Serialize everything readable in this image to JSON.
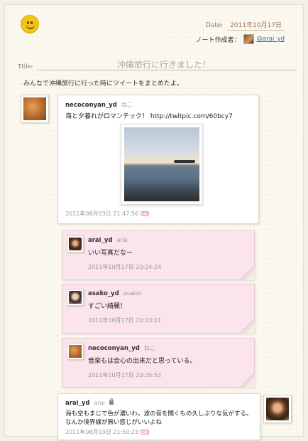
{
  "header": {
    "date_label": "Date:",
    "date_value": "2011年10月17日",
    "author_label": "ノート作成者：",
    "author_handle": "@arai_yd",
    "title_label": "Title:",
    "title": "沖縄旅行に行きました！",
    "summary": "みんなで沖縄旅行に行った時にツイートをまとめたよ。"
  },
  "tweets": [
    {
      "user": "necoconyan_yd",
      "name": "ねこ",
      "text": "海と夕暮れがロマンチック！ http://twitpic.com/60bcy7",
      "time": "2011年08月03日 21:47:56"
    },
    {
      "user": "arai_yd",
      "name": "arai",
      "text": "いい写真だなー",
      "time": "2011年10月17日 20:24:24"
    },
    {
      "user": "asako_yd",
      "name": "asakoi",
      "text": "すごい綺麗！",
      "time": "2011年10月17日 20:33:01"
    },
    {
      "user": "necoconyan_yd",
      "name": "ねこ",
      "text": "音楽もは会心の出来だと思っている。",
      "time": "2011年10月17日 20:35:53"
    },
    {
      "user": "arai_yd",
      "name": "arai",
      "text": "海も空もまじで色が濃いわ。波の音を聞くもの久しぶりな気がする。なんか境界線が無い感じがいいよね",
      "time": "2011年08月03日 21:50:23"
    }
  ],
  "reply_icon_text": "返信"
}
